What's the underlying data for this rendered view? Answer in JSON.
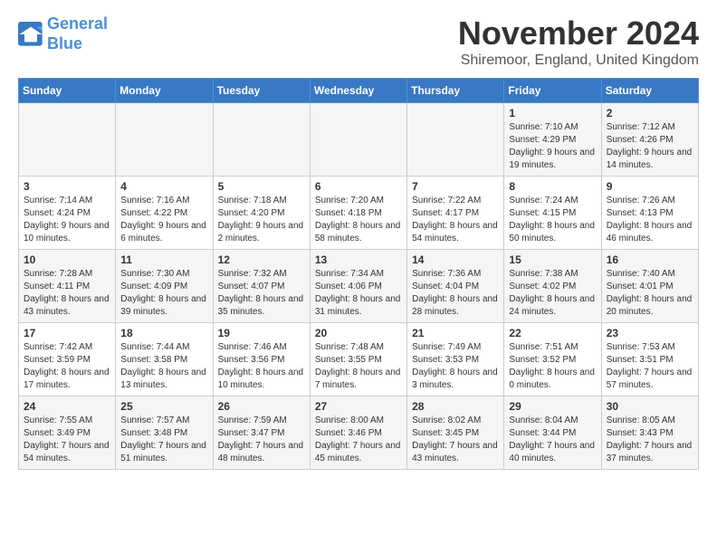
{
  "header": {
    "logo_line1": "General",
    "logo_line2": "Blue",
    "month_title": "November 2024",
    "location": "Shiremoor, England, United Kingdom"
  },
  "days_of_week": [
    "Sunday",
    "Monday",
    "Tuesday",
    "Wednesday",
    "Thursday",
    "Friday",
    "Saturday"
  ],
  "weeks": [
    [
      {
        "day": "",
        "info": ""
      },
      {
        "day": "",
        "info": ""
      },
      {
        "day": "",
        "info": ""
      },
      {
        "day": "",
        "info": ""
      },
      {
        "day": "",
        "info": ""
      },
      {
        "day": "1",
        "info": "Sunrise: 7:10 AM\nSunset: 4:29 PM\nDaylight: 9 hours and 19 minutes."
      },
      {
        "day": "2",
        "info": "Sunrise: 7:12 AM\nSunset: 4:26 PM\nDaylight: 9 hours and 14 minutes."
      }
    ],
    [
      {
        "day": "3",
        "info": "Sunrise: 7:14 AM\nSunset: 4:24 PM\nDaylight: 9 hours and 10 minutes."
      },
      {
        "day": "4",
        "info": "Sunrise: 7:16 AM\nSunset: 4:22 PM\nDaylight: 9 hours and 6 minutes."
      },
      {
        "day": "5",
        "info": "Sunrise: 7:18 AM\nSunset: 4:20 PM\nDaylight: 9 hours and 2 minutes."
      },
      {
        "day": "6",
        "info": "Sunrise: 7:20 AM\nSunset: 4:18 PM\nDaylight: 8 hours and 58 minutes."
      },
      {
        "day": "7",
        "info": "Sunrise: 7:22 AM\nSunset: 4:17 PM\nDaylight: 8 hours and 54 minutes."
      },
      {
        "day": "8",
        "info": "Sunrise: 7:24 AM\nSunset: 4:15 PM\nDaylight: 8 hours and 50 minutes."
      },
      {
        "day": "9",
        "info": "Sunrise: 7:26 AM\nSunset: 4:13 PM\nDaylight: 8 hours and 46 minutes."
      }
    ],
    [
      {
        "day": "10",
        "info": "Sunrise: 7:28 AM\nSunset: 4:11 PM\nDaylight: 8 hours and 43 minutes."
      },
      {
        "day": "11",
        "info": "Sunrise: 7:30 AM\nSunset: 4:09 PM\nDaylight: 8 hours and 39 minutes."
      },
      {
        "day": "12",
        "info": "Sunrise: 7:32 AM\nSunset: 4:07 PM\nDaylight: 8 hours and 35 minutes."
      },
      {
        "day": "13",
        "info": "Sunrise: 7:34 AM\nSunset: 4:06 PM\nDaylight: 8 hours and 31 minutes."
      },
      {
        "day": "14",
        "info": "Sunrise: 7:36 AM\nSunset: 4:04 PM\nDaylight: 8 hours and 28 minutes."
      },
      {
        "day": "15",
        "info": "Sunrise: 7:38 AM\nSunset: 4:02 PM\nDaylight: 8 hours and 24 minutes."
      },
      {
        "day": "16",
        "info": "Sunrise: 7:40 AM\nSunset: 4:01 PM\nDaylight: 8 hours and 20 minutes."
      }
    ],
    [
      {
        "day": "17",
        "info": "Sunrise: 7:42 AM\nSunset: 3:59 PM\nDaylight: 8 hours and 17 minutes."
      },
      {
        "day": "18",
        "info": "Sunrise: 7:44 AM\nSunset: 3:58 PM\nDaylight: 8 hours and 13 minutes."
      },
      {
        "day": "19",
        "info": "Sunrise: 7:46 AM\nSunset: 3:56 PM\nDaylight: 8 hours and 10 minutes."
      },
      {
        "day": "20",
        "info": "Sunrise: 7:48 AM\nSunset: 3:55 PM\nDaylight: 8 hours and 7 minutes."
      },
      {
        "day": "21",
        "info": "Sunrise: 7:49 AM\nSunset: 3:53 PM\nDaylight: 8 hours and 3 minutes."
      },
      {
        "day": "22",
        "info": "Sunrise: 7:51 AM\nSunset: 3:52 PM\nDaylight: 8 hours and 0 minutes."
      },
      {
        "day": "23",
        "info": "Sunrise: 7:53 AM\nSunset: 3:51 PM\nDaylight: 7 hours and 57 minutes."
      }
    ],
    [
      {
        "day": "24",
        "info": "Sunrise: 7:55 AM\nSunset: 3:49 PM\nDaylight: 7 hours and 54 minutes."
      },
      {
        "day": "25",
        "info": "Sunrise: 7:57 AM\nSunset: 3:48 PM\nDaylight: 7 hours and 51 minutes."
      },
      {
        "day": "26",
        "info": "Sunrise: 7:59 AM\nSunset: 3:47 PM\nDaylight: 7 hours and 48 minutes."
      },
      {
        "day": "27",
        "info": "Sunrise: 8:00 AM\nSunset: 3:46 PM\nDaylight: 7 hours and 45 minutes."
      },
      {
        "day": "28",
        "info": "Sunrise: 8:02 AM\nSunset: 3:45 PM\nDaylight: 7 hours and 43 minutes."
      },
      {
        "day": "29",
        "info": "Sunrise: 8:04 AM\nSunset: 3:44 PM\nDaylight: 7 hours and 40 minutes."
      },
      {
        "day": "30",
        "info": "Sunrise: 8:05 AM\nSunset: 3:43 PM\nDaylight: 7 hours and 37 minutes."
      }
    ]
  ]
}
